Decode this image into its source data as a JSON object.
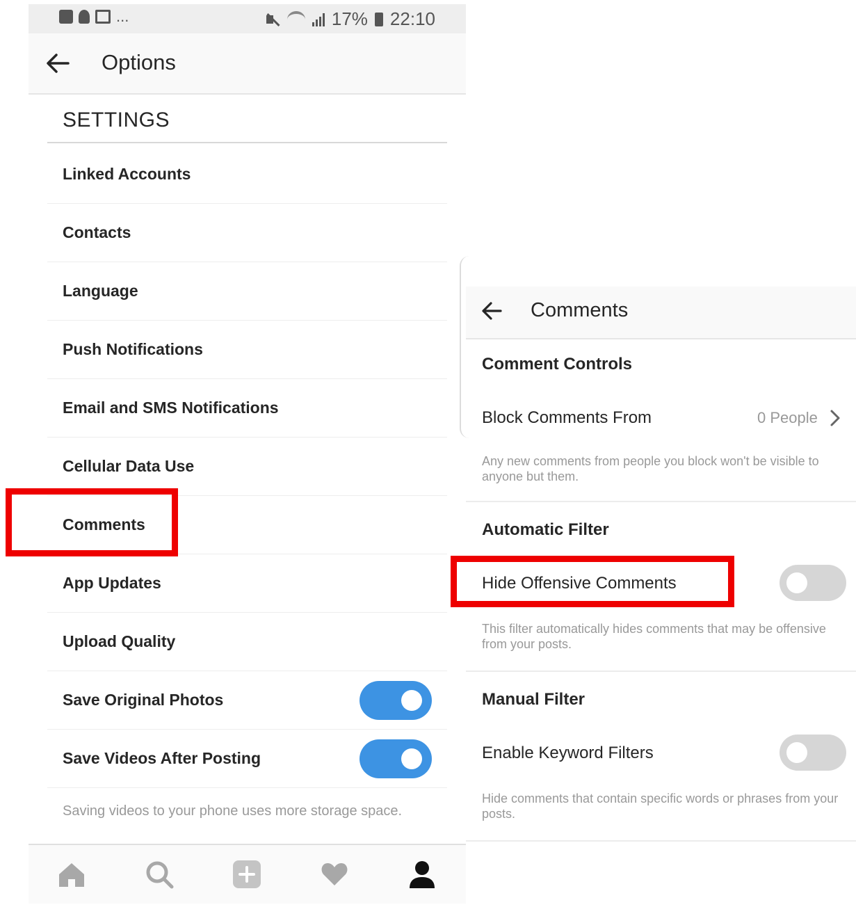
{
  "status_bar": {
    "battery": "17%",
    "time": "22:10",
    "overflow": "..."
  },
  "left_screen": {
    "title": "Options",
    "section_heading": "SETTINGS",
    "menu_items": [
      {
        "label": "Linked Accounts"
      },
      {
        "label": "Contacts"
      },
      {
        "label": "Language"
      },
      {
        "label": "Push Notifications"
      },
      {
        "label": "Email and SMS Notifications"
      },
      {
        "label": "Cellular Data Use"
      },
      {
        "label": "Comments"
      },
      {
        "label": "App Updates"
      },
      {
        "label": "Upload Quality"
      },
      {
        "label": "Save Original Photos",
        "toggle": true
      },
      {
        "label": "Save Videos After Posting",
        "toggle": true
      }
    ],
    "footnote": "Saving videos to your phone uses more storage space.",
    "tab_bar": [
      "home-icon",
      "search-icon",
      "add-post-icon",
      "heart-icon",
      "profile-icon"
    ],
    "highlight": "Comments"
  },
  "right_screen": {
    "title": "Comments",
    "comment_controls": {
      "heading": "Comment Controls",
      "block_label": "Block Comments From",
      "block_value": "0 People",
      "block_desc": "Any new comments from people you block won't be visible to anyone but them."
    },
    "automatic_filter": {
      "heading": "Automatic Filter",
      "option_label": "Hide Offensive Comments",
      "enabled": false,
      "desc": "This filter automatically hides comments that may be offensive from your posts."
    },
    "manual_filter": {
      "heading": "Manual Filter",
      "option_label": "Enable Keyword Filters",
      "enabled": false,
      "desc": "Hide comments that contain specific words or phrases from your posts."
    },
    "highlight": "Hide Offensive Comments"
  },
  "colors": {
    "toggle_on": "#3d93e3",
    "toggle_off": "#d6d6d6",
    "highlight": "#ee0000",
    "muted_text": "#999999"
  }
}
